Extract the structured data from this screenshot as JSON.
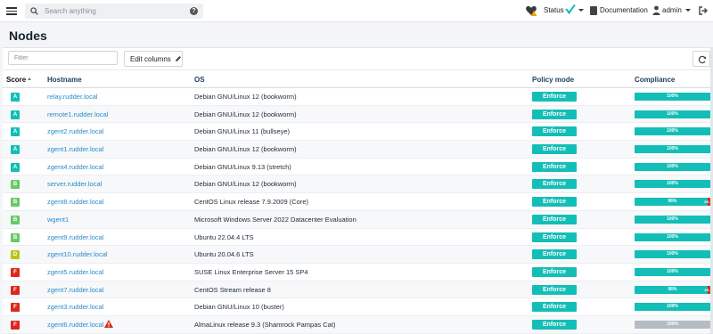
{
  "topbar": {
    "search_placeholder": "Search anything",
    "help_label": "?",
    "status_label": "Status",
    "documentation_label": "Documentation",
    "user_label": "admin"
  },
  "page": {
    "title": "Nodes"
  },
  "toolbar": {
    "filter_placeholder": "Filter",
    "edit_columns_label": "Edit columns"
  },
  "table": {
    "columns": [
      "Score",
      "Hostname",
      "OS",
      "Policy mode",
      "Compliance"
    ],
    "rows": [
      {
        "score": "A",
        "score_color": "#13beb7",
        "hostname": "relay.rudder.local",
        "os": "Debian GNU/Linux 12 (bookworm)",
        "policy": "Enforce",
        "compliance": 100,
        "compliance_label": "100%",
        "error_label": "",
        "bar_color": "#13beb7",
        "warning": false
      },
      {
        "score": "A",
        "score_color": "#13beb7",
        "hostname": "remote1.rudder.local",
        "os": "Debian GNU/Linux 12 (bookworm)",
        "policy": "Enforce",
        "compliance": 100,
        "compliance_label": "100%",
        "error_label": "",
        "bar_color": "#13beb7",
        "warning": false
      },
      {
        "score": "A",
        "score_color": "#13beb7",
        "hostname": "zgent2.rudder.local",
        "os": "Debian GNU/Linux 11 (bullseye)",
        "policy": "Enforce",
        "compliance": 100,
        "compliance_label": "100%",
        "error_label": "",
        "bar_color": "#13beb7",
        "warning": false
      },
      {
        "score": "A",
        "score_color": "#13beb7",
        "hostname": "zgent1.rudder.local",
        "os": "Debian GNU/Linux 12 (bookworm)",
        "policy": "Enforce",
        "compliance": 100,
        "compliance_label": "100%",
        "error_label": "",
        "bar_color": "#13beb7",
        "warning": false
      },
      {
        "score": "A",
        "score_color": "#13beb7",
        "hostname": "zgent4.rudder.local",
        "os": "Debian GNU/Linux 9.13 (stretch)",
        "policy": "Enforce",
        "compliance": 100,
        "compliance_label": "100%",
        "error_label": "",
        "bar_color": "#13beb7",
        "warning": false
      },
      {
        "score": "B",
        "score_color": "#68c96a",
        "hostname": "server.rudder.local",
        "os": "Debian GNU/Linux 12 (bookworm)",
        "policy": "Enforce",
        "compliance": 100,
        "compliance_label": "100%",
        "error_label": "",
        "bar_color": "#13beb7",
        "warning": false
      },
      {
        "score": "B",
        "score_color": "#68c96a",
        "hostname": "zgent8.rudder.local",
        "os": "CentOS Linux release 7.9.2009 (Core)",
        "policy": "Enforce",
        "compliance": 96,
        "compliance_label": "96%",
        "error_label": "5%",
        "bar_color": "#13beb7",
        "warning": false
      },
      {
        "score": "B",
        "score_color": "#68c96a",
        "hostname": "wgent1",
        "os": "Microsoft Windows Server 2022 Datacenter Evaluation",
        "policy": "Enforce",
        "compliance": 100,
        "compliance_label": "100%",
        "error_label": "",
        "bar_color": "#13beb7",
        "warning": false
      },
      {
        "score": "B",
        "score_color": "#68c96a",
        "hostname": "zgent9.rudder.local",
        "os": "Ubuntu 22.04.4 LTS",
        "policy": "Enforce",
        "compliance": 100,
        "compliance_label": "100%",
        "error_label": "",
        "bar_color": "#13beb7",
        "warning": false
      },
      {
        "score": "D",
        "score_color": "#b5c71a",
        "hostname": "zgent10.rudder.local",
        "os": "Ubuntu 20.04.6 LTS",
        "policy": "Enforce",
        "compliance": 100,
        "compliance_label": "100%",
        "error_label": "",
        "bar_color": "#13beb7",
        "warning": false
      },
      {
        "score": "F",
        "score_color": "#da291c",
        "hostname": "zgent5.rudder.local",
        "os": "SUSE Linux Enterprise Server 15 SP4",
        "policy": "Enforce",
        "compliance": 100,
        "compliance_label": "100%",
        "error_label": "",
        "bar_color": "#13beb7",
        "warning": false
      },
      {
        "score": "F",
        "score_color": "#da291c",
        "hostname": "zgent7.rudder.local",
        "os": "CentOS Stream release 8",
        "policy": "Enforce",
        "compliance": 96,
        "compliance_label": "96%",
        "error_label": "4%",
        "bar_color": "#13beb7",
        "warning": false
      },
      {
        "score": "F",
        "score_color": "#da291c",
        "hostname": "zgent3.rudder.local",
        "os": "Debian GNU/Linux 10 (buster)",
        "policy": "Enforce",
        "compliance": 100,
        "compliance_label": "100%",
        "error_label": "",
        "bar_color": "#13beb7",
        "warning": false
      },
      {
        "score": "F",
        "score_color": "#da291c",
        "hostname": "zgent6.rudder.local",
        "os": "AlmaLinux release 9.3 (Shamrock Pampas Cat)",
        "policy": "Enforce",
        "compliance": 100,
        "compliance_label": "100%",
        "error_label": "",
        "bar_color": "#b5bcc4",
        "warning": true
      }
    ]
  },
  "colors": {
    "accent": "#13beb7",
    "error": "#da291c",
    "link": "#2a8ac9",
    "warning": "#da291c"
  },
  "icons": [
    "menu-icon",
    "search-icon",
    "help-icon",
    "heartbeat-warning-icon",
    "status-check-icon",
    "documentation-icon",
    "user-icon",
    "logout-icon",
    "pencil-icon",
    "refresh-icon",
    "sort-asc-icon",
    "warning-icon"
  ]
}
